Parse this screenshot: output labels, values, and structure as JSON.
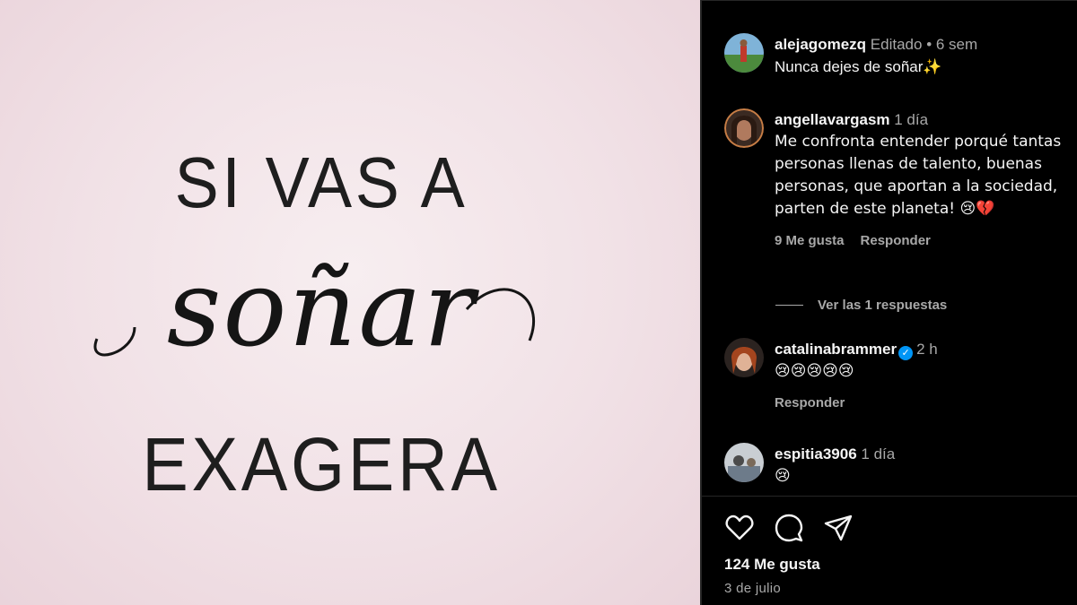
{
  "post_image": {
    "line1": "SI VAS A",
    "line2": "soñar",
    "line3": "EXAGERA"
  },
  "caption": {
    "username": "alejagomezq",
    "edited": "Editado",
    "separator": "•",
    "time": "6 sem",
    "text": "Nunca dejes de soñar✨"
  },
  "comments": [
    {
      "username": "angellavargasm",
      "time": "1 día",
      "text": "Me confronta entender porqué tantas personas llenas de talento, buenas personas, que aportan a la sociedad, parten de este planeta! 😢💔",
      "likes": "9 Me gusta",
      "reply": "Responder"
    },
    {
      "username": "catalinabrammer",
      "verified": true,
      "time": "2 h",
      "text": "😢😢😢😢😢",
      "reply": "Responder"
    },
    {
      "username": "espitia3906",
      "time": "1 día",
      "text": "😢"
    }
  ],
  "view_replies": "Ver las 1 respuestas",
  "action_icons": [
    "heart-icon",
    "comment-icon",
    "share-icon"
  ],
  "likes_total": "124 Me gusta",
  "post_date": "3 de julio",
  "colors": {
    "background": "#000000",
    "text_primary": "#f5f5f5",
    "text_secondary": "#a8a8a8",
    "verified": "#0095f6",
    "image_bg": "#f1e1e6"
  }
}
